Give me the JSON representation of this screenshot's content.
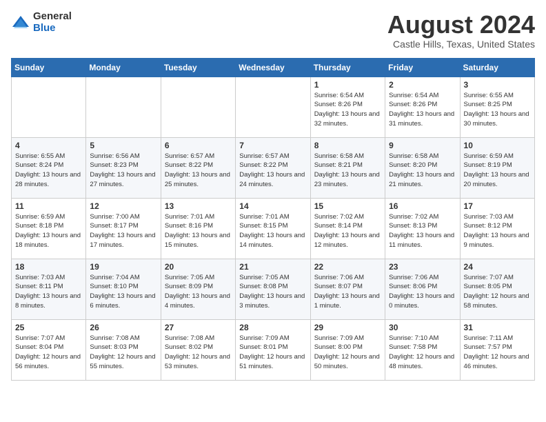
{
  "logo": {
    "general": "General",
    "blue": "Blue"
  },
  "title": "August 2024",
  "location": "Castle Hills, Texas, United States",
  "weekdays": [
    "Sunday",
    "Monday",
    "Tuesday",
    "Wednesday",
    "Thursday",
    "Friday",
    "Saturday"
  ],
  "weeks": [
    [
      {
        "day": "",
        "info": ""
      },
      {
        "day": "",
        "info": ""
      },
      {
        "day": "",
        "info": ""
      },
      {
        "day": "",
        "info": ""
      },
      {
        "day": "1",
        "info": "Sunrise: 6:54 AM\nSunset: 8:26 PM\nDaylight: 13 hours\nand 32 minutes."
      },
      {
        "day": "2",
        "info": "Sunrise: 6:54 AM\nSunset: 8:26 PM\nDaylight: 13 hours\nand 31 minutes."
      },
      {
        "day": "3",
        "info": "Sunrise: 6:55 AM\nSunset: 8:25 PM\nDaylight: 13 hours\nand 30 minutes."
      }
    ],
    [
      {
        "day": "4",
        "info": "Sunrise: 6:55 AM\nSunset: 8:24 PM\nDaylight: 13 hours\nand 28 minutes."
      },
      {
        "day": "5",
        "info": "Sunrise: 6:56 AM\nSunset: 8:23 PM\nDaylight: 13 hours\nand 27 minutes."
      },
      {
        "day": "6",
        "info": "Sunrise: 6:57 AM\nSunset: 8:22 PM\nDaylight: 13 hours\nand 25 minutes."
      },
      {
        "day": "7",
        "info": "Sunrise: 6:57 AM\nSunset: 8:22 PM\nDaylight: 13 hours\nand 24 minutes."
      },
      {
        "day": "8",
        "info": "Sunrise: 6:58 AM\nSunset: 8:21 PM\nDaylight: 13 hours\nand 23 minutes."
      },
      {
        "day": "9",
        "info": "Sunrise: 6:58 AM\nSunset: 8:20 PM\nDaylight: 13 hours\nand 21 minutes."
      },
      {
        "day": "10",
        "info": "Sunrise: 6:59 AM\nSunset: 8:19 PM\nDaylight: 13 hours\nand 20 minutes."
      }
    ],
    [
      {
        "day": "11",
        "info": "Sunrise: 6:59 AM\nSunset: 8:18 PM\nDaylight: 13 hours\nand 18 minutes."
      },
      {
        "day": "12",
        "info": "Sunrise: 7:00 AM\nSunset: 8:17 PM\nDaylight: 13 hours\nand 17 minutes."
      },
      {
        "day": "13",
        "info": "Sunrise: 7:01 AM\nSunset: 8:16 PM\nDaylight: 13 hours\nand 15 minutes."
      },
      {
        "day": "14",
        "info": "Sunrise: 7:01 AM\nSunset: 8:15 PM\nDaylight: 13 hours\nand 14 minutes."
      },
      {
        "day": "15",
        "info": "Sunrise: 7:02 AM\nSunset: 8:14 PM\nDaylight: 13 hours\nand 12 minutes."
      },
      {
        "day": "16",
        "info": "Sunrise: 7:02 AM\nSunset: 8:13 PM\nDaylight: 13 hours\nand 11 minutes."
      },
      {
        "day": "17",
        "info": "Sunrise: 7:03 AM\nSunset: 8:12 PM\nDaylight: 13 hours\nand 9 minutes."
      }
    ],
    [
      {
        "day": "18",
        "info": "Sunrise: 7:03 AM\nSunset: 8:11 PM\nDaylight: 13 hours\nand 8 minutes."
      },
      {
        "day": "19",
        "info": "Sunrise: 7:04 AM\nSunset: 8:10 PM\nDaylight: 13 hours\nand 6 minutes."
      },
      {
        "day": "20",
        "info": "Sunrise: 7:05 AM\nSunset: 8:09 PM\nDaylight: 13 hours\nand 4 minutes."
      },
      {
        "day": "21",
        "info": "Sunrise: 7:05 AM\nSunset: 8:08 PM\nDaylight: 13 hours\nand 3 minutes."
      },
      {
        "day": "22",
        "info": "Sunrise: 7:06 AM\nSunset: 8:07 PM\nDaylight: 13 hours\nand 1 minute."
      },
      {
        "day": "23",
        "info": "Sunrise: 7:06 AM\nSunset: 8:06 PM\nDaylight: 13 hours\nand 0 minutes."
      },
      {
        "day": "24",
        "info": "Sunrise: 7:07 AM\nSunset: 8:05 PM\nDaylight: 12 hours\nand 58 minutes."
      }
    ],
    [
      {
        "day": "25",
        "info": "Sunrise: 7:07 AM\nSunset: 8:04 PM\nDaylight: 12 hours\nand 56 minutes."
      },
      {
        "day": "26",
        "info": "Sunrise: 7:08 AM\nSunset: 8:03 PM\nDaylight: 12 hours\nand 55 minutes."
      },
      {
        "day": "27",
        "info": "Sunrise: 7:08 AM\nSunset: 8:02 PM\nDaylight: 12 hours\nand 53 minutes."
      },
      {
        "day": "28",
        "info": "Sunrise: 7:09 AM\nSunset: 8:01 PM\nDaylight: 12 hours\nand 51 minutes."
      },
      {
        "day": "29",
        "info": "Sunrise: 7:09 AM\nSunset: 8:00 PM\nDaylight: 12 hours\nand 50 minutes."
      },
      {
        "day": "30",
        "info": "Sunrise: 7:10 AM\nSunset: 7:58 PM\nDaylight: 12 hours\nand 48 minutes."
      },
      {
        "day": "31",
        "info": "Sunrise: 7:11 AM\nSunset: 7:57 PM\nDaylight: 12 hours\nand 46 minutes."
      }
    ]
  ]
}
